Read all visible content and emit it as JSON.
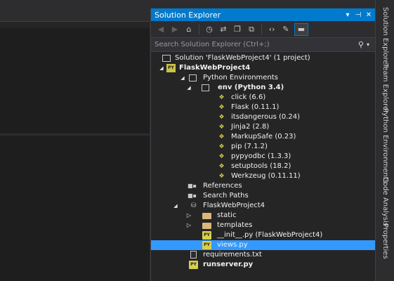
{
  "solution_explorer": {
    "title": "Solution Explorer",
    "title_icons": [
      "dropdown-arrow-icon",
      "pin-icon",
      "close-icon"
    ],
    "search_placeholder": "Search Solution Explorer (Ctrl+;)",
    "toolbar_icons": [
      "back-icon",
      "forward-icon",
      "home-icon",
      "history-icon",
      "sync-icon",
      "collapse-icon",
      "show-all-files-icon",
      "code-view-icon",
      "properties-icon",
      "preview-icon"
    ],
    "tree": [
      {
        "label": "Solution 'FlaskWebProject4' (1 project)",
        "icon": "solution-icon",
        "bold": false,
        "expanded": null
      },
      {
        "label": "FlaskWebProject4",
        "icon": "python-project-icon",
        "bold": true,
        "expanded": true
      },
      {
        "label": "Python Environments",
        "icon": "environments-icon",
        "bold": false,
        "expanded": true
      },
      {
        "label": "env (Python 3.4)",
        "icon": "environment-icon",
        "bold": true,
        "expanded": true
      },
      {
        "label": "click (6.6)",
        "icon": "package-icon",
        "bold": false,
        "expanded": null
      },
      {
        "label": "Flask (0.11.1)",
        "icon": "package-icon",
        "bold": false,
        "expanded": null
      },
      {
        "label": "itsdangerous (0.24)",
        "icon": "package-icon",
        "bold": false,
        "expanded": null
      },
      {
        "label": "Jinja2 (2.8)",
        "icon": "package-icon",
        "bold": false,
        "expanded": null
      },
      {
        "label": "MarkupSafe (0.23)",
        "icon": "package-icon",
        "bold": false,
        "expanded": null
      },
      {
        "label": "pip (7.1.2)",
        "icon": "package-icon",
        "bold": false,
        "expanded": null
      },
      {
        "label": "pypyodbc (1.3.3)",
        "icon": "package-icon",
        "bold": false,
        "expanded": null
      },
      {
        "label": "setuptools (18.2)",
        "icon": "package-icon",
        "bold": false,
        "expanded": null
      },
      {
        "label": "Werkzeug (0.11.11)",
        "icon": "package-icon",
        "bold": false,
        "expanded": null
      },
      {
        "label": "References",
        "icon": "references-icon",
        "bold": false,
        "expanded": null
      },
      {
        "label": "Search Paths",
        "icon": "search-paths-icon",
        "bold": false,
        "expanded": null
      },
      {
        "label": "FlaskWebProject4",
        "icon": "package-folder-icon",
        "bold": false,
        "expanded": true
      },
      {
        "label": "static",
        "icon": "folder-icon",
        "bold": false,
        "expanded": false
      },
      {
        "label": "templates",
        "icon": "folder-icon",
        "bold": false,
        "expanded": false
      },
      {
        "label": "__init__.py (FlaskWebProject4)",
        "icon": "python-file-icon",
        "bold": false,
        "expanded": null
      },
      {
        "label": "views.py",
        "icon": "python-file-icon",
        "bold": false,
        "expanded": null,
        "selected": true
      },
      {
        "label": "requirements.txt",
        "icon": "text-file-icon",
        "bold": false,
        "expanded": null
      },
      {
        "label": "runserver.py",
        "icon": "python-file-icon",
        "bold": true,
        "expanded": null
      }
    ]
  },
  "vertical_tabs": [
    {
      "label": "Solution Explorer",
      "active": true
    },
    {
      "label": "Team Explorer",
      "active": false
    },
    {
      "label": "Python Environments",
      "active": false
    },
    {
      "label": "Code Analysis",
      "active": false
    },
    {
      "label": "Properties",
      "active": false
    }
  ],
  "colors": {
    "accent": "#007acc",
    "selection": "#3399ff",
    "panel_bg": "#252526",
    "editor_bg": "#1e1e1e"
  }
}
